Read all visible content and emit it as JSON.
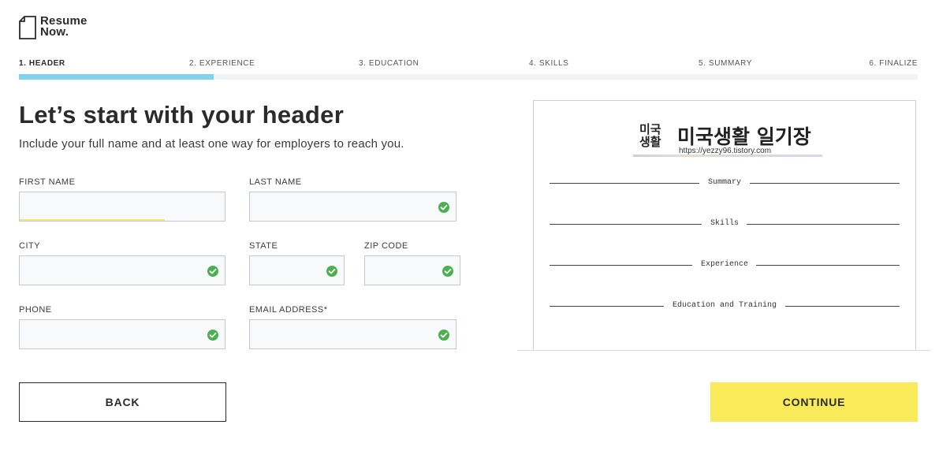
{
  "brand": {
    "line1": "Resume",
    "line2": "Now."
  },
  "steps": [
    "1. HEADER",
    "2. EXPERIENCE",
    "3. EDUCATION",
    "4. SKILLS",
    "5. SUMMARY",
    "6. FINALIZE"
  ],
  "progress": {
    "current_step": 1,
    "total_steps": 6,
    "fraction": 0.2167
  },
  "heading": {
    "title": "Let’s start with your header",
    "subtitle": "Include your full name and at least one way for employers to reach you."
  },
  "form": {
    "first_name": {
      "label": "FIRST NAME",
      "value": ""
    },
    "last_name": {
      "label": "LAST NAME",
      "value": ""
    },
    "city": {
      "label": "CITY",
      "value": ""
    },
    "state": {
      "label": "STATE",
      "value": ""
    },
    "zip": {
      "label": "ZIP CODE",
      "value": ""
    },
    "phone": {
      "label": "PHONE",
      "value": ""
    },
    "email": {
      "label": "EMAIL ADDRESS*",
      "value": ""
    }
  },
  "buttons": {
    "back": "BACK",
    "continue": "CONTINUE"
  },
  "preview": {
    "brand_small_1": "미국",
    "brand_small_2": "생활",
    "brand_big": "미국생활 일기장",
    "url": "https://yezzy96.tistory.com",
    "sections": [
      "Summary",
      "Skills",
      "Experience",
      "Education and Training"
    ]
  },
  "colors": {
    "progress": "#7fd3ec",
    "continue": "#f9ea5a",
    "check": "#4caf50",
    "focus": "#f7e66d"
  },
  "icons": {
    "logo": "document-icon",
    "valid": "check-circle-icon"
  }
}
